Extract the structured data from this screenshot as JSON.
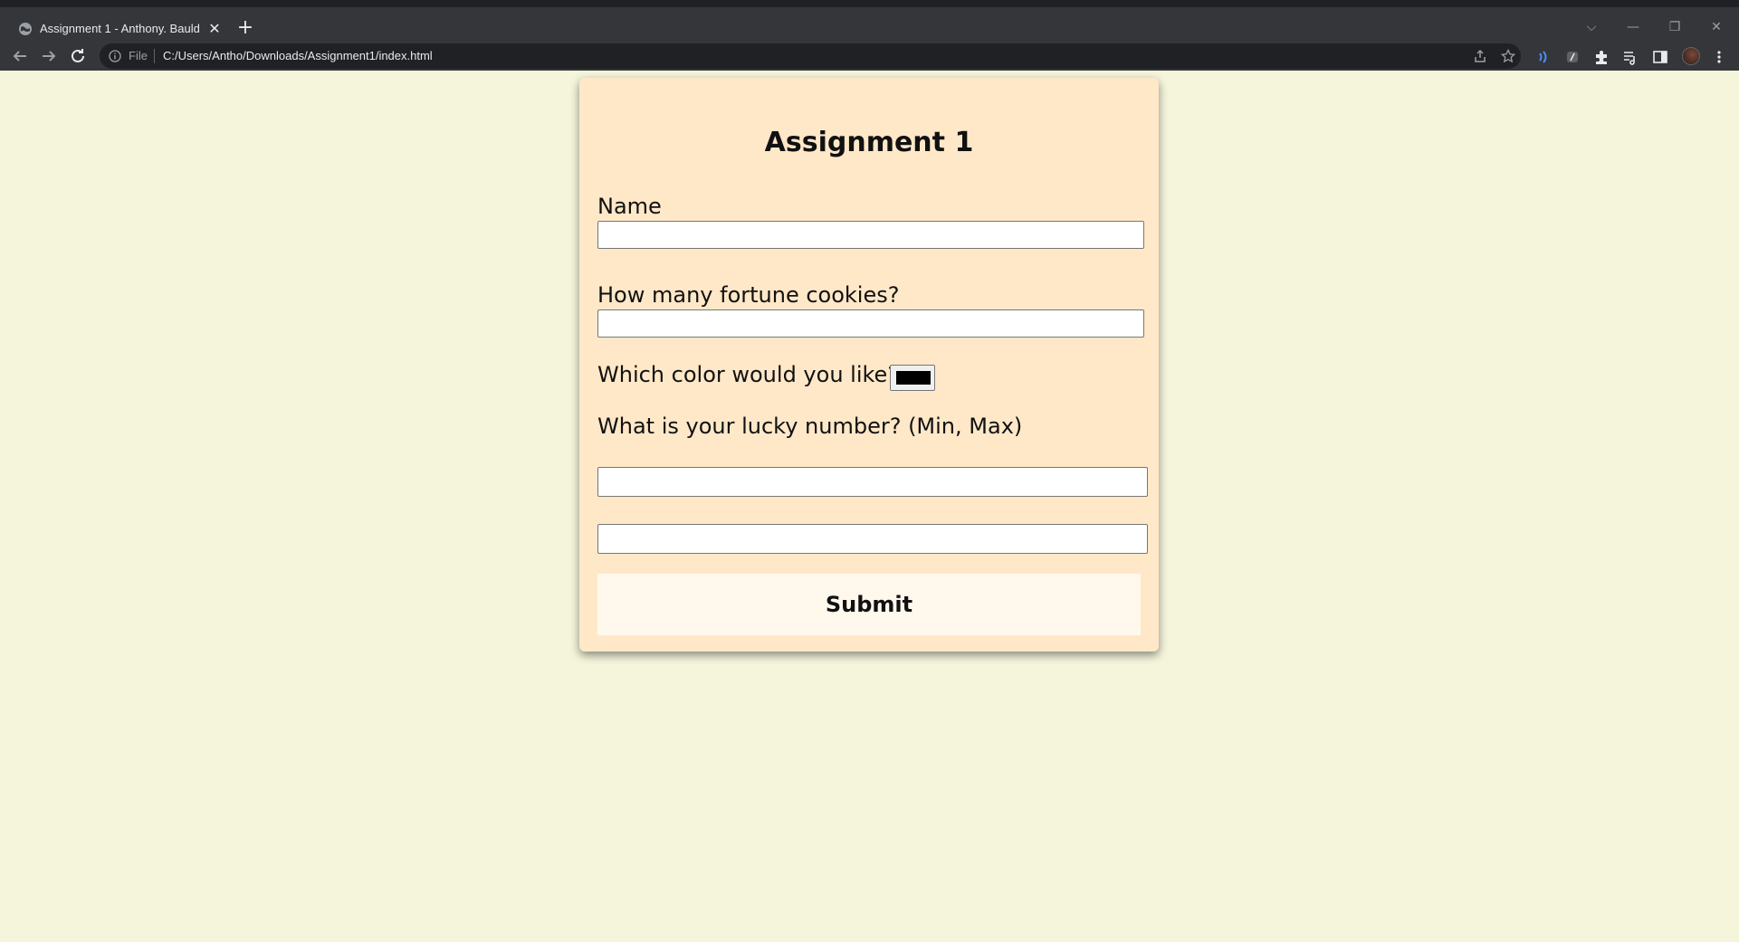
{
  "browser": {
    "tab_title": "Assignment 1 - Anthony. Bauld",
    "tab_close": "✕",
    "new_tab": "+",
    "scheme_label": "File",
    "url": "C:/Users/Antho/Downloads/Assignment1/index.html",
    "window_controls": [
      "⌵",
      "—",
      "❐",
      "✕"
    ]
  },
  "form": {
    "title": "Assignment 1",
    "name_label": "Name",
    "cookies_label": "How many fortune cookies?",
    "color_label": "Which color would you like?",
    "color_value": "#000000",
    "lucky_label": "What is your lucky number? (Min, Max)",
    "submit_label": "Submit"
  },
  "colors": {
    "page_background": "#f5f5dc",
    "card_background": "#ffe8c8",
    "button_background": "#fff8ec"
  }
}
